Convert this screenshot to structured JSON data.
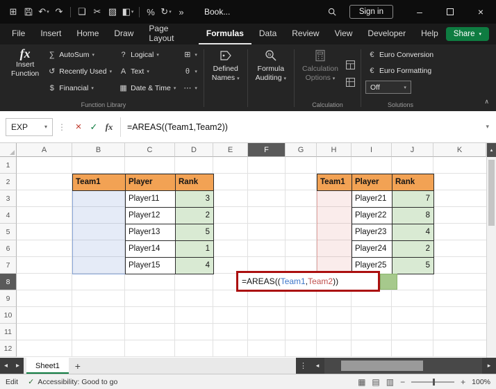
{
  "ui": {
    "chevron_down": "▾",
    "chevron_up": "∧",
    "overflow": "»",
    "dots_v": "⋮",
    "tri_left": "◂",
    "tri_right": "▸",
    "tri_up": "▴",
    "minimize": "–",
    "close": "×",
    "plus": "+"
  },
  "titlebar": {
    "workbook_name": "Book...",
    "sign_in": "Sign in",
    "qat": [
      {
        "name": "excel-logo",
        "glyph": "⊞"
      },
      {
        "name": "undo",
        "glyph": "↶"
      },
      {
        "name": "redo",
        "glyph": "↷"
      },
      {
        "name": "copy",
        "glyph": "❏"
      },
      {
        "name": "cut",
        "glyph": "✂"
      },
      {
        "name": "picture",
        "glyph": "▨"
      },
      {
        "name": "format-painter",
        "glyph": "◧"
      },
      {
        "name": "percent",
        "glyph": "%"
      },
      {
        "name": "refresh",
        "glyph": "↻"
      }
    ]
  },
  "ribbon": {
    "tabs": [
      {
        "label": "File"
      },
      {
        "label": "Insert"
      },
      {
        "label": "Home"
      },
      {
        "label": "Draw"
      },
      {
        "label": "Page Layout"
      },
      {
        "label": "Formulas"
      },
      {
        "label": "Data"
      },
      {
        "label": "Review"
      },
      {
        "label": "View"
      },
      {
        "label": "Developer"
      },
      {
        "label": "Help"
      }
    ],
    "share": "Share",
    "insert_function": {
      "icon": "fx",
      "line1": "Insert",
      "line2": "Function"
    },
    "function_library": {
      "label": "Function Library",
      "col1": [
        {
          "icon": "∑",
          "label": "AutoSum"
        },
        {
          "icon": "↺",
          "label": "Recently Used"
        },
        {
          "icon": "$",
          "label": "Financial"
        }
      ],
      "col2": [
        {
          "icon": "?",
          "label": "Logical"
        },
        {
          "icon": "A",
          "label": "Text"
        },
        {
          "icon": "▦",
          "label": "Date & Time"
        }
      ],
      "col3": [
        {
          "icon": "⊞"
        },
        {
          "icon": "θ"
        },
        {
          "icon": "⋯"
        }
      ]
    },
    "defined_names": {
      "line1": "Defined",
      "line2": "Names"
    },
    "formula_auditing": {
      "line1": "Formula",
      "line2": "Auditing"
    },
    "calculation": {
      "label": "Calculation",
      "line1": "Calculation",
      "line2": "Options"
    },
    "solutions": {
      "label": "Solutions",
      "item1": "Euro Conversion",
      "item2": "Euro Formatting",
      "euro": "€",
      "dropdown_value": "Off"
    }
  },
  "formula_bar": {
    "name_box": "EXP",
    "cancel": "×",
    "enter": "✓",
    "fx": "fx",
    "formula": {
      "p1": "=AREAS((",
      "ref1": "Team1",
      "p2": ",",
      "ref2": "Team2",
      "p3": "))"
    }
  },
  "grid": {
    "columns": [
      "A",
      "B",
      "C",
      "D",
      "E",
      "F",
      "G",
      "H",
      "I",
      "J",
      "K"
    ],
    "rows": [
      "1",
      "2",
      "3",
      "4",
      "5",
      "6",
      "7",
      "8",
      "9",
      "10",
      "11",
      "12"
    ],
    "active_column": "F",
    "active_row": "8",
    "table1": {
      "title": "Team1",
      "col_player": "Player",
      "col_rank": "Rank",
      "players": [
        "Player11",
        "Player12",
        "Player13",
        "Player14",
        "Player15"
      ],
      "ranks": [
        "3",
        "2",
        "5",
        "1",
        "4"
      ]
    },
    "table2": {
      "title": "Team1",
      "col_player": "Player",
      "col_rank": "Rank",
      "players": [
        "Player21",
        "Player22",
        "Player23",
        "Player24",
        "Player25"
      ],
      "ranks": [
        "7",
        "8",
        "4",
        "2",
        "5"
      ]
    },
    "cell_formula": {
      "p1": "=AREAS((",
      "ref1": "Team1",
      "p2": ",",
      "ref2": "Team2",
      "p3": "))"
    }
  },
  "sheet_bar": {
    "sheet": "Sheet1"
  },
  "status_bar": {
    "mode": "Edit",
    "accessibility": "Accessibility: Good to go",
    "zoom": "100%"
  }
}
